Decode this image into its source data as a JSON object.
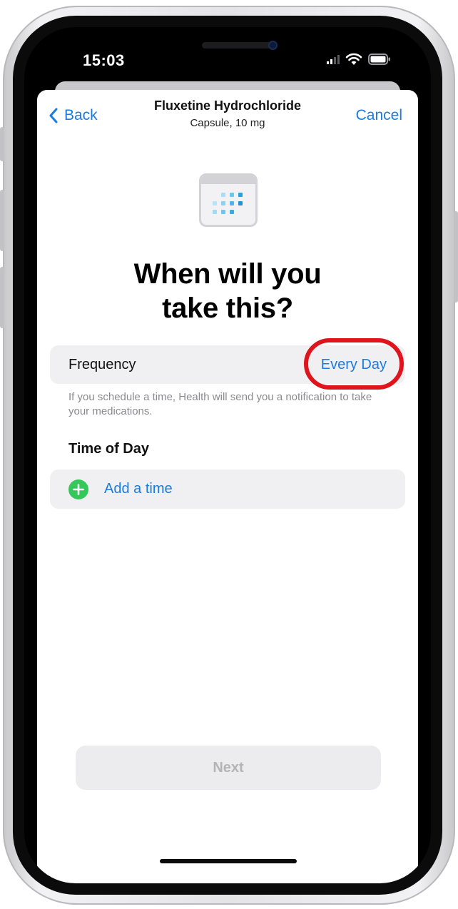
{
  "status_bar": {
    "time": "15:03"
  },
  "nav": {
    "back_label": "Back",
    "title": "Fluxetine Hydrochloride",
    "subtitle": "Capsule, 10 mg",
    "cancel_label": "Cancel"
  },
  "headline": {
    "line1": "When will you",
    "line2": "take this?"
  },
  "frequency": {
    "label": "Frequency",
    "value": "Every Day",
    "note": "If you schedule a time, Health will send you a notification to take your medications."
  },
  "time_of_day": {
    "header": "Time of Day",
    "add_label": "Add a time"
  },
  "footer": {
    "next_label": "Next"
  },
  "colors": {
    "accent": "#1a7be0",
    "highlight_ring": "#e0141c",
    "add_icon": "#34c759",
    "disabled_text": "#b4b4b8"
  },
  "icons": [
    "chevron-left-icon",
    "calendar-icon",
    "plus-circle-icon",
    "signal-icon",
    "wifi-icon",
    "battery-icon"
  ]
}
